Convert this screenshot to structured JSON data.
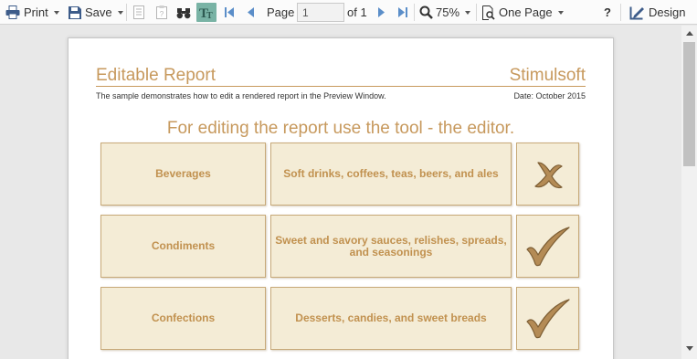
{
  "toolbar": {
    "print_label": "Print",
    "save_label": "Save",
    "page_label": "Page",
    "page_value": "1",
    "of_label": "of 1",
    "zoom_label": "75%",
    "view_mode_label": "One Page",
    "help_label": "?",
    "design_label": "Design",
    "active_tool_color": "#79b3a5"
  },
  "report": {
    "title": "Editable Report",
    "brand": "Stimulsoft",
    "subtitle": "The sample demonstrates how to edit a rendered report in the Preview Window.",
    "date": "Date: October 2015",
    "heading": "For editing the report use the tool - the editor.",
    "accent_color": "#c7995d",
    "rows": [
      {
        "category": "Beverages",
        "description": "Soft drinks, coffees, teas, beers, and ales",
        "mark": "cross-icon"
      },
      {
        "category": "Condiments",
        "description": "Sweet and savory sauces, relishes, spreads, and seasonings",
        "mark": "check-icon"
      },
      {
        "category": "Confections",
        "description": "Desserts, candies, and sweet breads",
        "mark": "check-icon"
      }
    ]
  }
}
